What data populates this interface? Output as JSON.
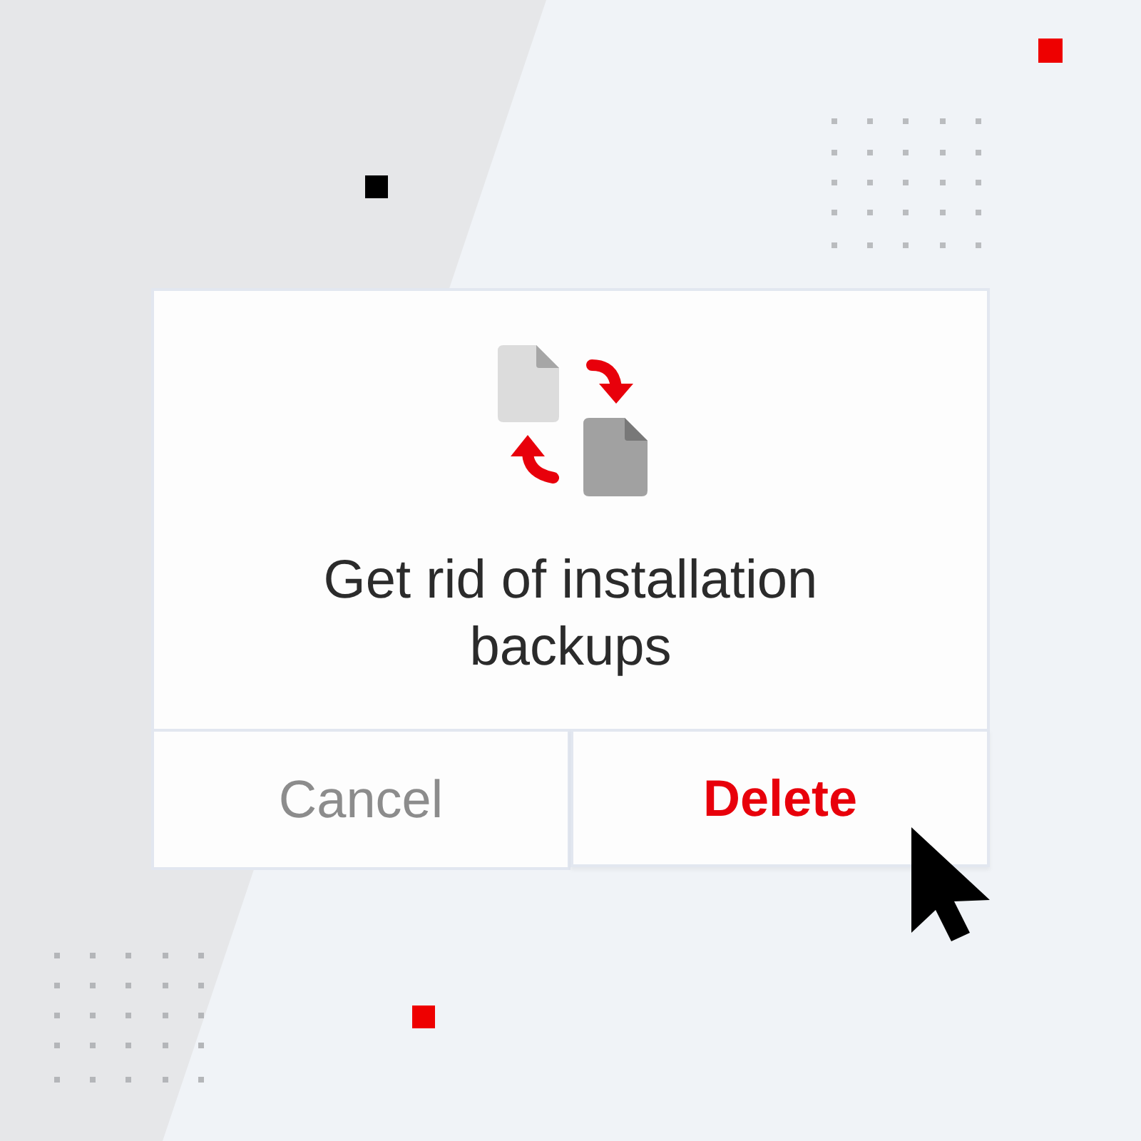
{
  "dialog": {
    "message": "Get rid of installation backups",
    "buttons": [
      {
        "label": "Cancel",
        "kind": "cancel",
        "hovered": false
      },
      {
        "label": "Delete",
        "kind": "destructive",
        "hovered": true
      }
    ]
  }
}
